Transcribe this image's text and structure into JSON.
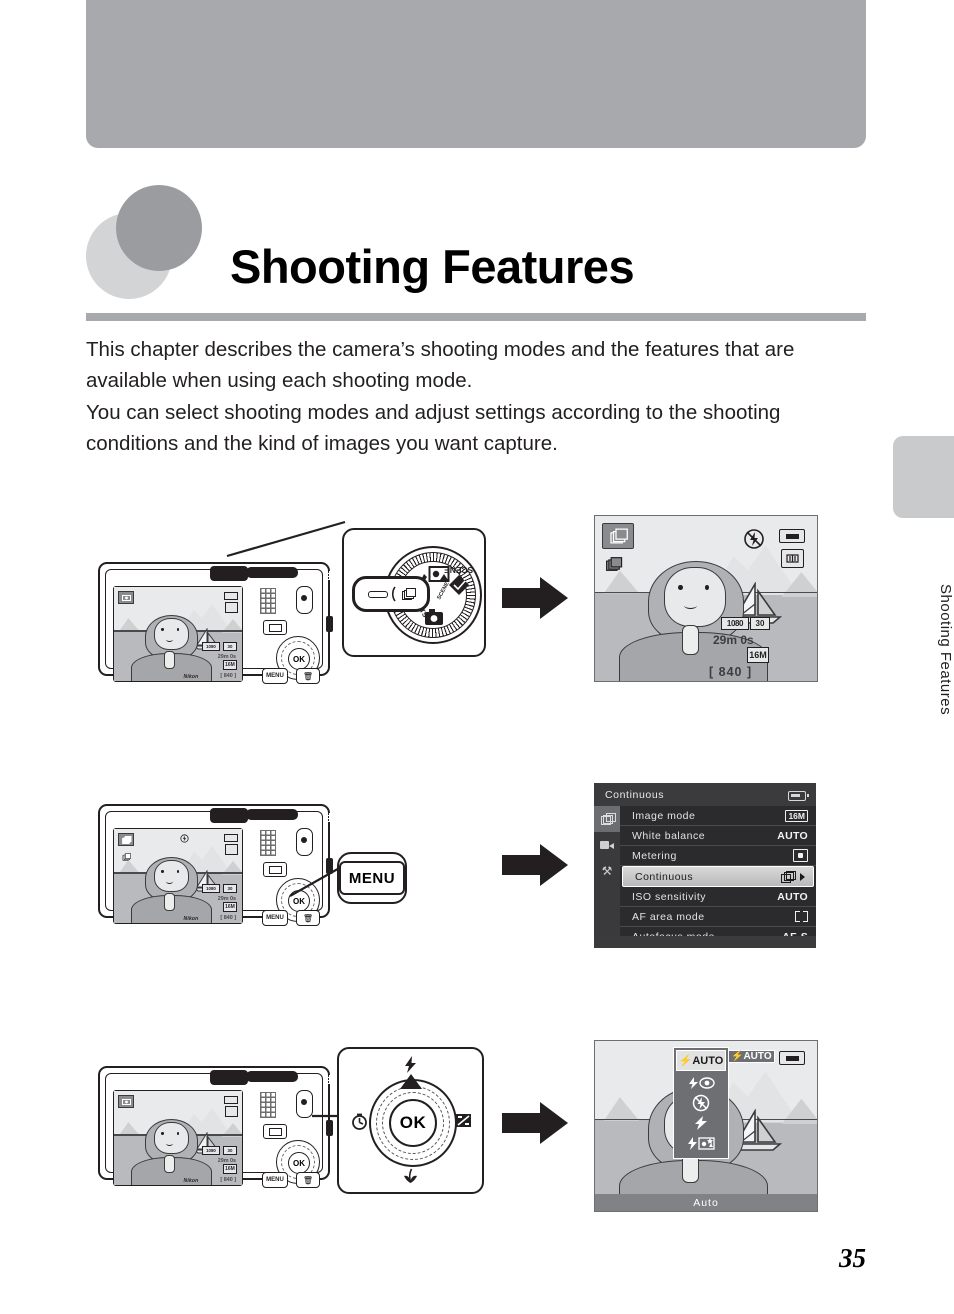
{
  "page": {
    "chapter_title": "Shooting Features",
    "page_number": "35",
    "side_tab_label": "Shooting Features",
    "intro_paragraph_1": "This chapter describes the camera’s shooting modes and the features that are available when using each shooting mode.",
    "intro_paragraph_2": "You can select shooting modes and adjust settings according to the shooting conditions and the kind of images you want capture."
  },
  "colors": {
    "header_band": "#a7a9ac",
    "title_rule": "#a7a9ac",
    "side_tab": "#c9cacc",
    "circle_light": "#d3d4d6",
    "circle_dark": "#9a9ca0",
    "menu_selected": "#d9d9d9",
    "ink": "#231f20"
  },
  "figure1": {
    "caption_arrow": "arrow-right",
    "camera": {
      "menu_button_label": "MENU",
      "ok_button_label": "OK",
      "brand": "Nikon"
    },
    "mode_dial": {
      "labels": [
        "SCENE",
        "EFFECTS",
        "SCENE"
      ],
      "selected_mode": "continuous-shooting",
      "icons": [
        "pet-portrait-icon",
        "night-portrait-icon",
        "scene-auto-selector-icon",
        "auto-mode-icon",
        "special-effects-icon",
        "continuous-icon"
      ]
    },
    "lcd": {
      "mode_badge": "continuous-icon",
      "secondary_badge": "continuous-small-icon",
      "flash_indicator": "flash-off-icon",
      "battery_indicator": "battery-icon",
      "vr_indicator": "vibration-reduction-icon",
      "movie_quality": "1080",
      "movie_rate": "30",
      "recording_time": "29m 0s",
      "image_size": "16M",
      "shots_remaining": "[  840 ]"
    }
  },
  "figure2": {
    "callout_button_label": "MENU",
    "menu": {
      "title": "Continuous",
      "battery_indicator": "battery-icon",
      "side_tabs": [
        {
          "name": "shooting-menu-tab",
          "icon": "continuous-icon",
          "active": true
        },
        {
          "name": "movie-menu-tab",
          "icon": "movie-camera-icon",
          "active": false
        },
        {
          "name": "setup-menu-tab",
          "icon": "wrench-icon",
          "active": false
        }
      ],
      "rows": [
        {
          "label": "Image mode",
          "value": "16M",
          "value_type": "badge",
          "selected": false
        },
        {
          "label": "White balance",
          "value": "AUTO",
          "value_type": "text",
          "selected": false
        },
        {
          "label": "Metering",
          "value": "",
          "value_type": "metering-icon",
          "selected": false
        },
        {
          "label": "Continuous",
          "value": "",
          "value_type": "continuous-icon",
          "selected": true
        },
        {
          "label": "ISO sensitivity",
          "value": "AUTO",
          "value_type": "text",
          "selected": false
        },
        {
          "label": "AF area mode",
          "value": "",
          "value_type": "af-area-icon",
          "selected": false
        },
        {
          "label": "Autofocus mode",
          "value": "AF-S",
          "value_type": "text",
          "selected": false
        }
      ]
    }
  },
  "figure3": {
    "multi_selector": {
      "center_label": "OK",
      "up_icon": "flash-icon",
      "left_icon": "self-timer-icon",
      "right_icon": "exposure-compensation-icon",
      "down_icon": "macro-icon"
    },
    "flash_menu": {
      "selected_label": "AUTO",
      "selected_symbol": "⚡",
      "status_indicator": "AUTO",
      "battery_indicator": "battery-icon",
      "caption": "Auto",
      "options": [
        {
          "name": "flash-auto",
          "label": "AUTO",
          "selected": true
        },
        {
          "name": "flash-red-eye-reduction",
          "label": "",
          "selected": false
        },
        {
          "name": "flash-off",
          "label": "",
          "selected": false
        },
        {
          "name": "flash-fill",
          "label": "",
          "selected": false
        },
        {
          "name": "flash-slow-sync",
          "label": "",
          "selected": false
        }
      ]
    }
  }
}
